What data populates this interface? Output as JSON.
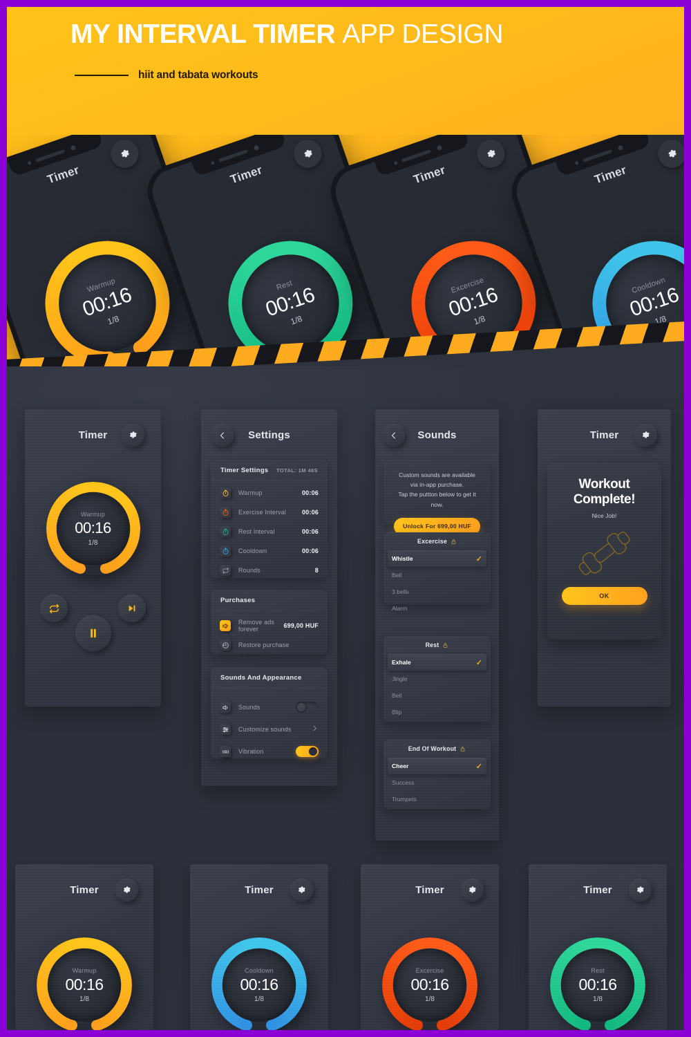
{
  "meta": {
    "accent": "#ffb81c",
    "purple": "#8b00d4",
    "dark_bg": "#2f333e"
  },
  "hero": {
    "title_bold": "MY INTERVAL TIMER",
    "title_light": "APP DESIGN",
    "subtitle": "hiit and tabata workouts"
  },
  "phones": [
    {
      "title": "Timer",
      "phase": "Warmup",
      "time": "00:16",
      "round": "1/8",
      "color": "#ffc41a",
      "color2": "#ff9e1b",
      "gear_icon": "gear-icon",
      "loop_icon": "loop-icon",
      "pause_icon": "pause-icon",
      "skip_icon": "skip-icon"
    },
    {
      "title": "Timer",
      "phase": "Rest",
      "time": "00:16",
      "round": "1/8",
      "color": "#2fd69a",
      "color2": "#12b981",
      "gear_icon": "gear-icon",
      "loop_icon": "loop-icon",
      "pause_icon": "pause-icon",
      "skip_icon": "skip-icon"
    },
    {
      "title": "Timer",
      "phase": "Excercise",
      "time": "00:16",
      "round": "1/8",
      "color": "#ff5a17",
      "color2": "#e83b06",
      "gear_icon": "gear-icon",
      "loop_icon": "loop-icon",
      "pause_icon": "pause-icon",
      "skip_icon": "skip-icon"
    },
    {
      "title": "Timer",
      "phase": "Cooldown",
      "time": "00:16",
      "round": "1/8",
      "color": "#3fc3ea",
      "color2": "#2b8fe0",
      "gear_icon": "gear-icon",
      "loop_icon": "loop-icon",
      "pause_icon": "pause-icon",
      "skip_icon": "skip-icon"
    }
  ],
  "timer_screen": {
    "title": "Timer",
    "gear_icon": "gear-icon",
    "phase": "Warmup",
    "time": "00:16",
    "round": "1/8",
    "color": "#ffc41a",
    "color2": "#ff9e1b",
    "loop_icon": "loop-icon",
    "pause_icon": "pause-icon",
    "skip_icon": "skip-icon"
  },
  "settings_screen": {
    "title": "Settings",
    "back_icon": "chevron-left-icon",
    "timer_card": {
      "header": "Timer Settings",
      "total": "TOTAL: 1M 48S",
      "rows": [
        {
          "icon": "stopwatch-icon",
          "icon_color": "#ffb81c",
          "label": "Warmup",
          "value": "00:06"
        },
        {
          "icon": "stopwatch-icon",
          "icon_color": "#f4601c",
          "label": "Exercise Interval",
          "value": "00:06"
        },
        {
          "icon": "stopwatch-icon",
          "icon_color": "#17b98a",
          "label": "Rest Interval",
          "value": "00:06"
        },
        {
          "icon": "stopwatch-icon",
          "icon_color": "#2ba8e0",
          "label": "Cooldown",
          "value": "00:06"
        },
        {
          "icon": "loop-icon",
          "icon_color": "#9aa0ab",
          "label": "Rounds",
          "value": "8"
        }
      ]
    },
    "purchases_card": {
      "header": "Purchases",
      "rows": [
        {
          "icon": "megaphone-icon",
          "icon_color": "#ffb81c",
          "label": "Remove ads forever",
          "value": "699,00 HUF"
        },
        {
          "icon": "restore-icon",
          "icon_color": "#9aa0ab",
          "label": "Restore purchase",
          "value": ""
        }
      ]
    },
    "sounds_card": {
      "header": "Sounds And Appearance",
      "rows": [
        {
          "icon": "speaker-icon",
          "label": "Sounds",
          "control": "toggle",
          "state": "off"
        },
        {
          "icon": "sliders-icon",
          "label": "Customize sounds",
          "control": "chevron",
          "state": ""
        },
        {
          "icon": "vibration-icon",
          "label": "Vibration",
          "control": "toggle",
          "state": "on"
        }
      ]
    }
  },
  "sounds_screen": {
    "title": "Sounds",
    "back_icon": "chevron-left-icon",
    "promo": {
      "line1": "Custom sounds are available",
      "line2": "via in-app purchase.",
      "line3": "Tap the puttton below to get it now.",
      "button": "Unlock For 699,00 HUF"
    },
    "groups": [
      {
        "name": "Excercise",
        "lock_icon": "lock-icon",
        "items": [
          {
            "label": "Whistle",
            "selected": true
          },
          {
            "label": "Bell",
            "selected": false
          },
          {
            "label": "3 bells",
            "selected": false
          },
          {
            "label": "Alarm",
            "selected": false
          }
        ]
      },
      {
        "name": "Rest",
        "lock_icon": "lock-icon",
        "items": [
          {
            "label": "Exhale",
            "selected": true
          },
          {
            "label": "Jingle",
            "selected": false
          },
          {
            "label": "Bell",
            "selected": false
          },
          {
            "label": "Blip",
            "selected": false
          }
        ]
      },
      {
        "name": "End Of Workout",
        "lock_icon": "lock-icon",
        "items": [
          {
            "label": "Cheer",
            "selected": true
          },
          {
            "label": "Success",
            "selected": false
          },
          {
            "label": "Trumpets",
            "selected": false
          }
        ]
      }
    ]
  },
  "complete_screen": {
    "title": "Timer",
    "gear_icon": "gear-icon",
    "headline": "Workout Complete!",
    "sub": "Nice Job!",
    "illustration_icon": "dumbbell-icon",
    "ok_label": "OK"
  },
  "bottom_row": [
    {
      "title": "Timer",
      "gear_icon": "gear-icon",
      "phase": "Warmup",
      "time": "00:16",
      "round": "1/8",
      "color": "#ffc41a",
      "color2": "#ff9e1b"
    },
    {
      "title": "Timer",
      "gear_icon": "gear-icon",
      "phase": "Cooldown",
      "time": "00:16",
      "round": "1/8",
      "color": "#40c5ea",
      "color2": "#3090e2"
    },
    {
      "title": "Timer",
      "gear_icon": "gear-icon",
      "phase": "Excercise",
      "time": "00:16",
      "round": "1/8",
      "color": "#ff5a17",
      "color2": "#e23c07"
    },
    {
      "title": "Timer",
      "gear_icon": "gear-icon",
      "phase": "Rest",
      "time": "00:16",
      "round": "1/8",
      "color": "#2fd69a",
      "color2": "#13b87f"
    }
  ]
}
